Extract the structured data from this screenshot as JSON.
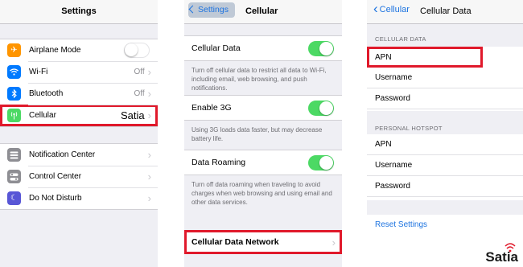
{
  "panel1": {
    "title": "Settings",
    "group1": [
      {
        "label": "Airplane Mode",
        "icon": "airplane-icon",
        "icon_color": "#ff9500",
        "control": "toggle-off"
      },
      {
        "label": "Wi-Fi",
        "icon": "wifi-icon",
        "icon_color": "#007aff",
        "value": "Off"
      },
      {
        "label": "Bluetooth",
        "icon": "bluetooth-icon",
        "icon_color": "#007aff",
        "value": "Off"
      },
      {
        "label": "Cellular",
        "icon": "cellular-icon",
        "icon_color": "#4cd964",
        "value": "Satia",
        "highlighted": true
      }
    ],
    "group2": [
      {
        "label": "Notification Center",
        "icon": "notification-icon",
        "icon_color": "#8e8e93"
      },
      {
        "label": "Control Center",
        "icon": "control-center-icon",
        "icon_color": "#8e8e93"
      },
      {
        "label": "Do Not Disturb",
        "icon": "moon-icon",
        "icon_color": "#5856d6"
      }
    ]
  },
  "panel2": {
    "back_label": "Settings",
    "title": "Cellular",
    "sections": [
      {
        "label": "Cellular Data",
        "toggle": "on",
        "description": "Turn off cellular data to restrict all data to Wi-Fi, including email, web browsing, and push notifications."
      },
      {
        "label": "Enable 3G",
        "toggle": "on",
        "description": "Using 3G loads data faster, but may decrease battery life."
      },
      {
        "label": "Data Roaming",
        "toggle": "on",
        "description": "Turn off data roaming when traveling to avoid charges when web browsing and using email and other data services."
      }
    ],
    "network_label": "Cellular Data Network"
  },
  "panel3": {
    "back_label": "Cellular",
    "title": "Cellular Data",
    "cellular_data_header": "CELLULAR DATA",
    "cellular_rows": [
      "APN",
      "Username",
      "Password"
    ],
    "hotspot_header": "PERSONAL HOTSPOT",
    "hotspot_rows": [
      "APN",
      "Username",
      "Password"
    ],
    "reset_label": "Reset Settings"
  },
  "brand": {
    "name": "Satia",
    "accent": "#e0192b"
  },
  "colors": {
    "highlight": "#e0192b",
    "toggle_on": "#4cd964",
    "link": "#1e74e0"
  }
}
